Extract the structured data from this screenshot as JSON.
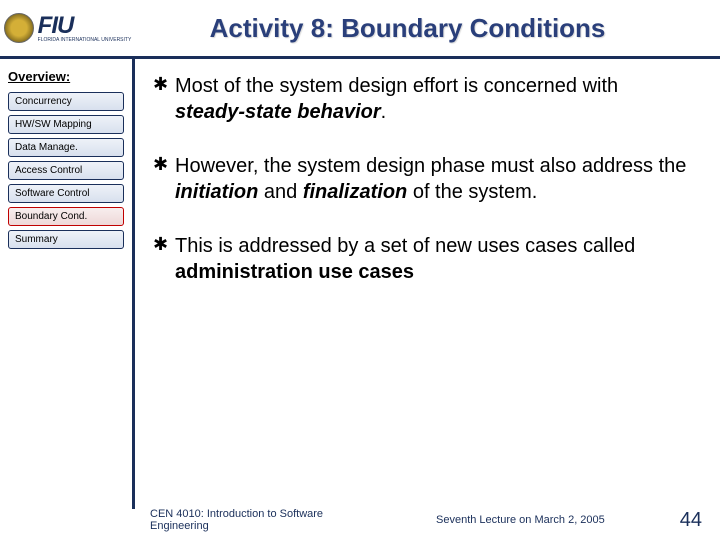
{
  "header": {
    "logo_text": "FIU",
    "logo_sub": "FLORIDA INTERNATIONAL UNIVERSITY",
    "title": "Activity 8: Boundary Conditions"
  },
  "sidebar": {
    "title": "Overview:",
    "items": [
      {
        "label": "Concurrency",
        "active": false
      },
      {
        "label": "HW/SW Mapping",
        "active": false
      },
      {
        "label": "Data Manage.",
        "active": false
      },
      {
        "label": "Access Control",
        "active": false
      },
      {
        "label": "Software Control",
        "active": false
      },
      {
        "label": "Boundary Cond.",
        "active": true
      },
      {
        "label": "Summary",
        "active": false
      }
    ]
  },
  "content": {
    "bullets": [
      {
        "pre": "Most of the system design effort is concerned with ",
        "em": "steady-state behavior",
        "post": "."
      },
      {
        "pre": "However, the system design phase must also address the ",
        "em": "initiation",
        "mid": " and ",
        "em2": "finalization",
        "post": " of the system."
      },
      {
        "pre": "This is addressed by a set of new uses cases called ",
        "em": "administration use cases",
        "post": ""
      }
    ]
  },
  "footer": {
    "left": "CEN 4010: Introduction to Software Engineering",
    "mid": "Seventh Lecture on March 2, 2005",
    "page": "44"
  }
}
